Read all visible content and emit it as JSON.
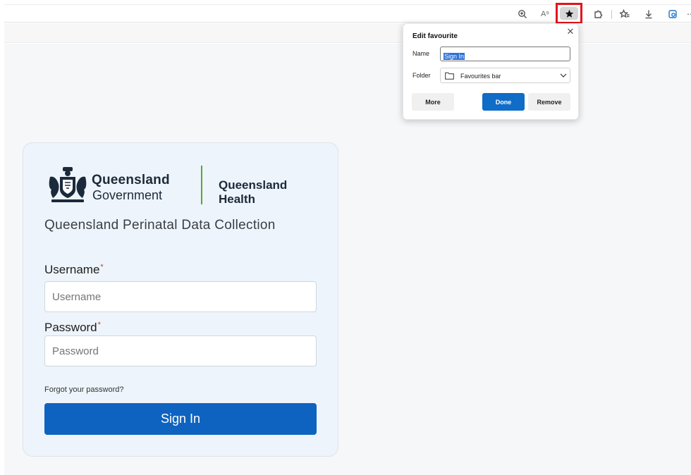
{
  "browser": {
    "toolbar_icons": [
      "zoom-icon",
      "read-aloud-icon",
      "favourite-star-icon",
      "extensions-icon",
      "favourites-list-icon",
      "downloads-icon",
      "collections-icon",
      "more-icon"
    ],
    "read_aloud_glyph": "A⁹",
    "highlight_color": "#e3141b"
  },
  "popup": {
    "title": "Edit favourite",
    "close_glyph": "✕",
    "name_label": "Name",
    "name_value": "Sign In",
    "folder_label": "Folder",
    "folder_value": "Favourites bar",
    "buttons": {
      "more": "More",
      "done": "Done",
      "remove": "Remove"
    },
    "done_color": "#0f6cc7"
  },
  "login": {
    "brand": {
      "gov_line1": "Queensland",
      "gov_line2": "Government",
      "dept": "Queensland Health",
      "divider_color": "#5aa832"
    },
    "form_title": "Queensland Perinatal Data Collection",
    "username_label": "Username",
    "username_placeholder": "Username",
    "password_label": "Password",
    "password_placeholder": "Password",
    "required_mark": "*",
    "forgot_link": "Forgot your password?",
    "sign_in_button": "Sign In",
    "accent_color": "#0f63c0"
  }
}
